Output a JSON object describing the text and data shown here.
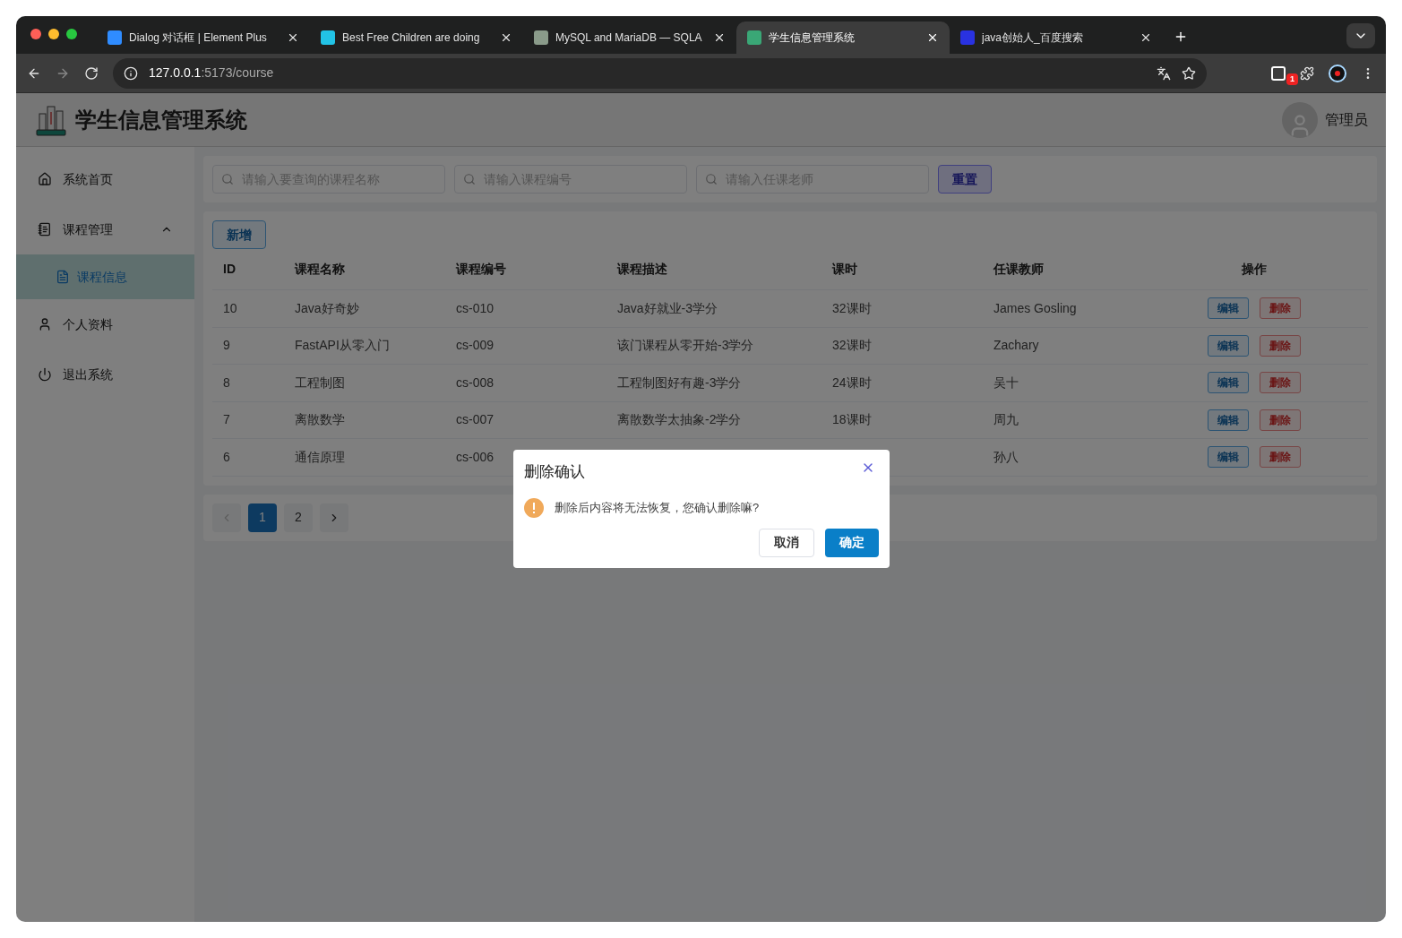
{
  "browser": {
    "tabs": [
      {
        "title": "Dialog 对话框 | Element Plus",
        "selected": false
      },
      {
        "title": "Best Free Children are doing",
        "selected": false
      },
      {
        "title": "MySQL and MariaDB — SQLA",
        "selected": false
      },
      {
        "title": "学生信息管理系统",
        "selected": true
      },
      {
        "title": "java创始人_百度搜索",
        "selected": false
      }
    ],
    "url_host": "127.0.0.1",
    "url_path": ":5173/course",
    "extension_badge": "1"
  },
  "app": {
    "title": "学生信息管理系统",
    "user": "管理员"
  },
  "sidebar": {
    "items": [
      {
        "label": "系统首页",
        "selected": false
      },
      {
        "label": "课程管理",
        "selected": false,
        "expanded": true,
        "children": [
          {
            "label": "课程信息",
            "selected": true
          }
        ]
      },
      {
        "label": "个人资料",
        "selected": false
      },
      {
        "label": "退出系统",
        "selected": false
      }
    ]
  },
  "search": {
    "fields": [
      {
        "placeholder": "请输入要查询的课程名称"
      },
      {
        "placeholder": "请输入课程编号"
      },
      {
        "placeholder": "请输入任课老师"
      }
    ],
    "reset_button": "重置"
  },
  "add_button": "新增",
  "table": {
    "columns": [
      "ID",
      "课程名称",
      "课程编号",
      "课程描述",
      "课时",
      "任课教师",
      "操作"
    ],
    "rows": [
      {
        "id": "10",
        "name": "Java好奇妙",
        "code": "cs-010",
        "description": "Java好就业-3学分",
        "hours": "32课时",
        "teacher": "James Gosling",
        "actions": [
          "编辑",
          "删除"
        ]
      },
      {
        "id": "9",
        "name": "FastAPI从零入门",
        "code": "cs-009",
        "description": "该门课程从零开始-3学分",
        "hours": "32课时",
        "teacher": "Zachary",
        "actions": [
          "编辑",
          "删除"
        ]
      },
      {
        "id": "8",
        "name": "工程制图",
        "code": "cs-008",
        "description": "工程制图好有趣-3学分",
        "hours": "24课时",
        "teacher": "吴十",
        "actions": [
          "编辑",
          "删除"
        ]
      },
      {
        "id": "7",
        "name": "离散数学",
        "code": "cs-007",
        "description": "离散数学太抽象-2学分",
        "hours": "18课时",
        "teacher": "周九",
        "actions": [
          "编辑",
          "删除"
        ]
      },
      {
        "id": "6",
        "name": "通信原理",
        "code": "cs-006",
        "teacher": "孙八",
        "actions": [
          "编辑",
          "删除"
        ]
      }
    ]
  },
  "pagination": {
    "prev_disabled": true,
    "next_disabled": false,
    "pages": [
      {
        "label": "1",
        "selected": true
      },
      {
        "label": "2",
        "selected": false
      }
    ]
  },
  "dialog": {
    "title": "删除确认",
    "message": "删除后内容将无法恢复，您确认删除嘛?",
    "buttons": [
      {
        "label": "取消",
        "kind": "cancel"
      },
      {
        "label": "确定",
        "kind": "confirm"
      }
    ]
  }
}
